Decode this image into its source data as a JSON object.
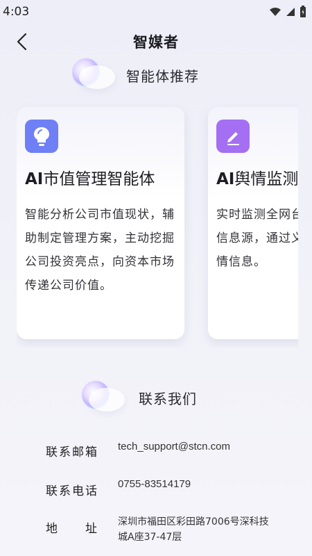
{
  "status_bar": {
    "time": "4:03"
  },
  "nav": {
    "title": "智媒者"
  },
  "recommend": {
    "title": "智能体推荐"
  },
  "cards": [
    {
      "title_prefix": "AI",
      "title_rest": "市值管理智能体",
      "description": "智能分析公司市值现状，辅助制定管理方案，主动挖掘公司投资亮点，向资本市场传递公司价值。",
      "icon": "lightbulb-icon",
      "icon_color": "#6f7ff6"
    },
    {
      "title_prefix": "AI",
      "title_rest": "舆情监测",
      "description": "实时监测全网台、新闻媒体信息源，通过义分析、筛选情信息。",
      "icon": "edit-icon",
      "icon_color": "#a46ff2"
    }
  ],
  "contact": {
    "title": "联系我们",
    "email_label": "联系邮箱",
    "email": "tech_support@stcn.com",
    "phone_label": "联系电话",
    "phone": "0755-83514179",
    "address_label": "地　　址",
    "address_line1": "深圳市福田区彩田路7006号深科技",
    "address_line2": "城A座37-47层"
  }
}
